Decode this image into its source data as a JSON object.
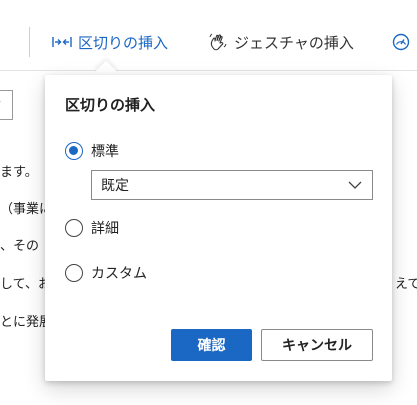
{
  "toolbar": {
    "break_label": "区切りの挿入",
    "gesture_label": "ジェスチャの挿入",
    "break_icon": "break-arrows-icon",
    "gesture_icon": "hand-wave-icon",
    "more_icon": "gauge-icon"
  },
  "background": {
    "lines": [
      "ます。",
      "（事業に",
      "、その",
      "して、お",
      "とに発展"
    ],
    "right_fragment": "えて"
  },
  "popup": {
    "title": "区切りの挿入",
    "options": {
      "standard": "標準",
      "detail": "詳細",
      "custom": "カスタム"
    },
    "selected": "standard",
    "select_value": "既定",
    "ok_label": "確認",
    "cancel_label": "キャンセル"
  },
  "colors": {
    "accent": "#1a67c4"
  }
}
